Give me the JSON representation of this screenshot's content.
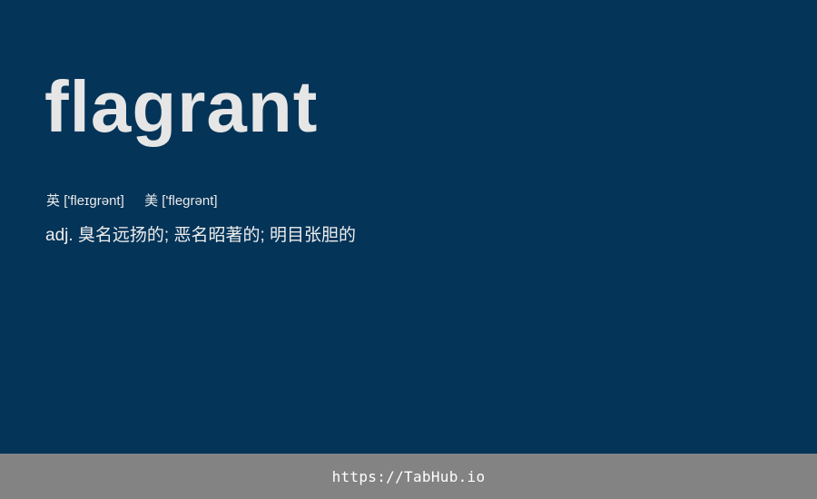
{
  "card": {
    "word": "flagrant",
    "phonetic_uk_label": "英",
    "phonetic_uk": "['fleɪɡrənt]",
    "phonetic_us_label": "美",
    "phonetic_us": "['fleɡrənt]",
    "definition": "adj. 臭名远扬的; 恶名昭著的; 明目张胆的"
  },
  "footer": {
    "url": "https://TabHub.io"
  },
  "colors": {
    "background": "#043458",
    "word": "#e6e6e6",
    "footer_background": "#838383",
    "footer_text": "#ffffff"
  }
}
